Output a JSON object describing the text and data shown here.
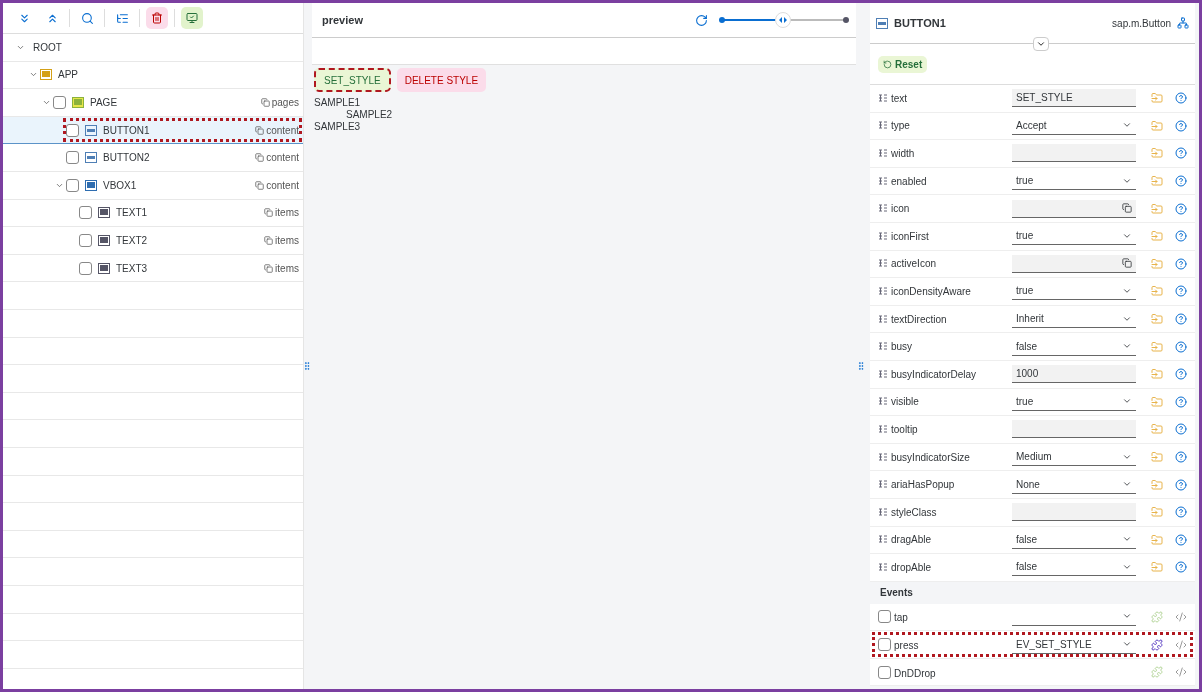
{
  "tree": [
    {
      "label": "ROOT",
      "expanded": true,
      "children": [
        {
          "label": "APP",
          "kind": "app",
          "expanded": true,
          "children": [
            {
              "label": "PAGE",
              "kind": "page",
              "expanded": true,
              "checked": false,
              "selected": false,
              "highlighted": false,
              "aggregation": "pages",
              "children": [
                {
                  "label": "BUTTON1",
                  "kind": "button",
                  "checked": false,
                  "selected": true,
                  "highlighted": true,
                  "aggregation": "content"
                },
                {
                  "label": "BUTTON2",
                  "kind": "button",
                  "checked": false,
                  "selected": false,
                  "highlighted": false,
                  "aggregation": "content"
                },
                {
                  "label": "VBOX1",
                  "kind": "vbox",
                  "expanded": true,
                  "checked": false,
                  "selected": false,
                  "highlighted": false,
                  "aggregation": "content",
                  "children": [
                    {
                      "label": "TEXT1",
                      "kind": "text",
                      "checked": false,
                      "selected": false,
                      "highlighted": false,
                      "aggregation": "items"
                    },
                    {
                      "label": "TEXT2",
                      "kind": "text",
                      "checked": false,
                      "selected": false,
                      "highlighted": false,
                      "aggregation": "items"
                    },
                    {
                      "label": "TEXT3",
                      "kind": "text",
                      "checked": false,
                      "selected": false,
                      "highlighted": false,
                      "aggregation": "items"
                    }
                  ]
                }
              ]
            }
          ]
        }
      ]
    }
  ],
  "preview": {
    "title": "preview",
    "zoom": {
      "level": 0.49
    },
    "buttons": [
      {
        "label": "SET_STYLE",
        "kind": "accept",
        "highlighted": true
      },
      {
        "label": "DELETE STYLE",
        "kind": "reject",
        "highlighted": false
      }
    ],
    "texts": [
      {
        "text": "SAMPLE1",
        "indented": false
      },
      {
        "text": "SAMPLE2",
        "indented": true
      },
      {
        "text": "SAMPLE3",
        "indented": false
      }
    ]
  },
  "inspector": {
    "title": "BUTTON1",
    "class_name": "sap.m.Button",
    "reset": "Reset",
    "properties": [
      {
        "name": "text",
        "kind": "input",
        "value": "SET_STYLE"
      },
      {
        "name": "type",
        "kind": "select",
        "value": "Accept"
      },
      {
        "name": "width",
        "kind": "input"
      },
      {
        "name": "enabled",
        "kind": "select",
        "value": "true"
      },
      {
        "name": "icon",
        "kind": "icon-input"
      },
      {
        "name": "iconFirst",
        "kind": "select",
        "value": "true"
      },
      {
        "name": "activeIcon",
        "kind": "icon-input"
      },
      {
        "name": "iconDensityAware",
        "kind": "select",
        "value": "true"
      },
      {
        "name": "textDirection",
        "kind": "select",
        "value": "Inherit"
      },
      {
        "name": "busy",
        "kind": "select",
        "value": "false"
      },
      {
        "name": "busyIndicatorDelay",
        "kind": "input",
        "value": "1000"
      },
      {
        "name": "visible",
        "kind": "select",
        "value": "true"
      },
      {
        "name": "tooltip",
        "kind": "input"
      },
      {
        "name": "busyIndicatorSize",
        "kind": "select",
        "value": "Medium"
      },
      {
        "name": "ariaHasPopup",
        "kind": "select",
        "value": "None"
      },
      {
        "name": "styleClass",
        "kind": "input"
      },
      {
        "name": "dragAble",
        "kind": "select",
        "value": "false"
      },
      {
        "name": "dropAble",
        "kind": "select",
        "value": "false"
      }
    ],
    "events_title": "Events",
    "events": [
      {
        "name": "tap",
        "kind": "select",
        "checked": false,
        "highlighted": false,
        "handler_set": false
      },
      {
        "name": "press",
        "kind": "select",
        "value": "EV_SET_STYLE",
        "checked": false,
        "highlighted": true,
        "handler_set": true
      },
      {
        "name": "DnDDrop",
        "kind": "none",
        "checked": false,
        "highlighted": false,
        "handler_set": false
      }
    ]
  }
}
